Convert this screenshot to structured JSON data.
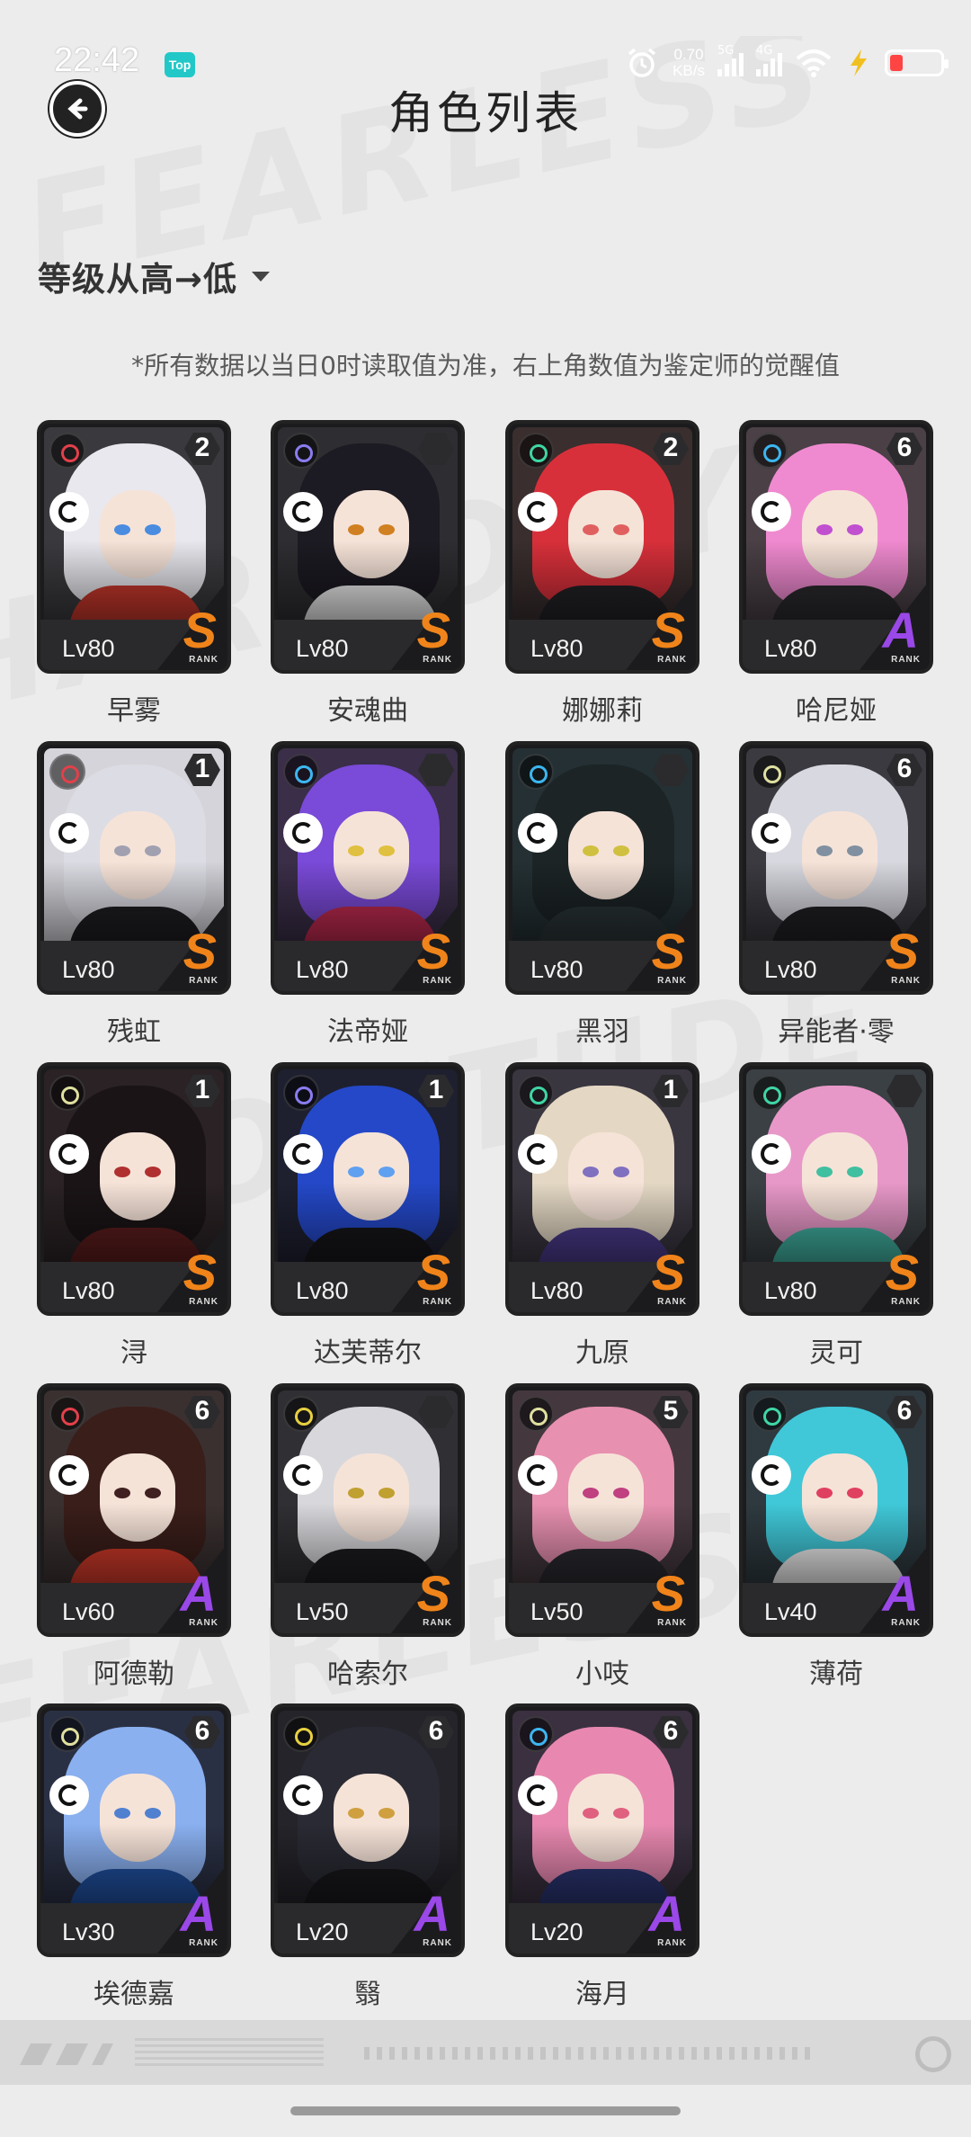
{
  "status_bar": {
    "time": "22:42",
    "app_badge": "Top",
    "net_speed": "0.70",
    "net_unit": "KB/s",
    "sig1": "5G",
    "sig2": "4G"
  },
  "header": {
    "title": "角色列表"
  },
  "sort": {
    "label": "等级从高→低"
  },
  "note": "*所有数据以当日0时读取值为准，右上角数值为鉴定师的觉醒值",
  "characters": [
    {
      "name": "早雾",
      "level": "Lv80",
      "rank": "S",
      "awaken": "2",
      "attr_color": "#e2404a",
      "hair": "#e8e8ee",
      "outfit": "#c8382c",
      "bg": "#3a3a3e",
      "eye": "#4a8ce0"
    },
    {
      "name": "安魂曲",
      "level": "Lv80",
      "rank": "S",
      "awaken": "",
      "attr_color": "#8a7cf0",
      "hair": "#1c1a22",
      "outfit": "#ececec",
      "bg": "#2e2e32",
      "eye": "#d08020"
    },
    {
      "name": "娜娜莉",
      "level": "Lv80",
      "rank": "S",
      "awaken": "2",
      "attr_color": "#3fd6a4",
      "hair": "#d8303a",
      "outfit": "#222226",
      "bg": "#3a2e2e",
      "eye": "#e06060"
    },
    {
      "name": "哈尼娅",
      "level": "Lv80",
      "rank": "A",
      "awaken": "6",
      "attr_color": "#3cb6f0",
      "hair": "#f08ad0",
      "outfit": "#2a2a2e",
      "bg": "#4a4046",
      "eye": "#c050d0"
    },
    {
      "name": "残虹",
      "level": "Lv80",
      "rank": "S",
      "awaken": "1",
      "attr_color": "#e2404a",
      "hair": "#dcdce4",
      "outfit": "#1e1e22",
      "bg": "#d4d4da",
      "eye": "#a0a0b0"
    },
    {
      "name": "法帝娅",
      "level": "Lv80",
      "rank": "S",
      "awaken": "",
      "attr_color": "#3cb6f0",
      "hair": "#7a4ad8",
      "outfit": "#c02a50",
      "bg": "#3a2e48",
      "eye": "#e0c040"
    },
    {
      "name": "黑羽",
      "level": "Lv80",
      "rank": "S",
      "awaken": "",
      "attr_color": "#3cb6f0",
      "hair": "#1c2426",
      "outfit": "#2a3436",
      "bg": "#243034",
      "eye": "#d0c040"
    },
    {
      "name": "异能者·零",
      "level": "Lv80",
      "rank": "S",
      "awaken": "6",
      "attr_color": "#e0e0a0",
      "hair": "#d8d8e0",
      "outfit": "#202024",
      "bg": "#3a3a40",
      "eye": "#8090a0"
    },
    {
      "name": "浔",
      "level": "Lv80",
      "rank": "S",
      "awaken": "1",
      "attr_color": "#e0e0a0",
      "hair": "#1a1416",
      "outfit": "#5a1c1c",
      "bg": "#2a2224",
      "eye": "#b03030"
    },
    {
      "name": "达芙蒂尔",
      "level": "Lv80",
      "rank": "S",
      "awaken": "1",
      "attr_color": "#8a7cf0",
      "hair": "#2448c8",
      "outfit": "#16161a",
      "bg": "#1e2030",
      "eye": "#60a0f0"
    },
    {
      "name": "九原",
      "level": "Lv80",
      "rank": "S",
      "awaken": "1",
      "attr_color": "#3fd6a4",
      "hair": "#e4d8c4",
      "outfit": "#4a3a8a",
      "bg": "#3a3640",
      "eye": "#8070c0"
    },
    {
      "name": "灵可",
      "level": "Lv80",
      "rank": "S",
      "awaken": "",
      "attr_color": "#3fd6a4",
      "hair": "#e898c8",
      "outfit": "#40b0a0",
      "bg": "#3a4044",
      "eye": "#40c0a0"
    },
    {
      "name": "阿德勒",
      "level": "Lv60",
      "rank": "A",
      "awaken": "6",
      "attr_color": "#e2404a",
      "hair": "#3a1e1a",
      "outfit": "#d03a2a",
      "bg": "#3a3030",
      "eye": "#402020"
    },
    {
      "name": "哈索尔",
      "level": "Lv50",
      "rank": "S",
      "awaken": "",
      "attr_color": "#e8d040",
      "hair": "#d8d8dc",
      "outfit": "#1c1c20",
      "bg": "#303034",
      "eye": "#c0a030"
    },
    {
      "name": "小吱",
      "level": "Lv50",
      "rank": "S",
      "awaken": "5",
      "attr_color": "#e0e0a0",
      "hair": "#e890b0",
      "outfit": "#2a2a30",
      "bg": "#44383e",
      "eye": "#c04080"
    },
    {
      "name": "薄荷",
      "level": "Lv40",
      "rank": "A",
      "awaken": "6",
      "attr_color": "#3fd6a4",
      "hair": "#40c8d8",
      "outfit": "#f0f0f0",
      "bg": "#2e3a40",
      "eye": "#e04060"
    },
    {
      "name": "埃德嘉",
      "level": "Lv30",
      "rank": "A",
      "awaken": "6",
      "attr_color": "#e0e0a0",
      "hair": "#8ab0f0",
      "outfit": "#2050a0",
      "bg": "#2a3044",
      "eye": "#5080d0"
    },
    {
      "name": "翳",
      "level": "Lv20",
      "rank": "A",
      "awaken": "6",
      "attr_color": "#e8d040",
      "hair": "#2a2a34",
      "outfit": "#18181c",
      "bg": "#24242a",
      "eye": "#d0a040"
    },
    {
      "name": "海月",
      "level": "Lv20",
      "rank": "A",
      "awaken": "6",
      "attr_color": "#3cb6f0",
      "hair": "#e888b0",
      "outfit": "#2a3470",
      "bg": "#3a3040",
      "eye": "#e06080"
    }
  ],
  "rank_colors": {
    "S": "#f0841a",
    "A": "#9a48e8"
  },
  "rank_word": "RANK"
}
